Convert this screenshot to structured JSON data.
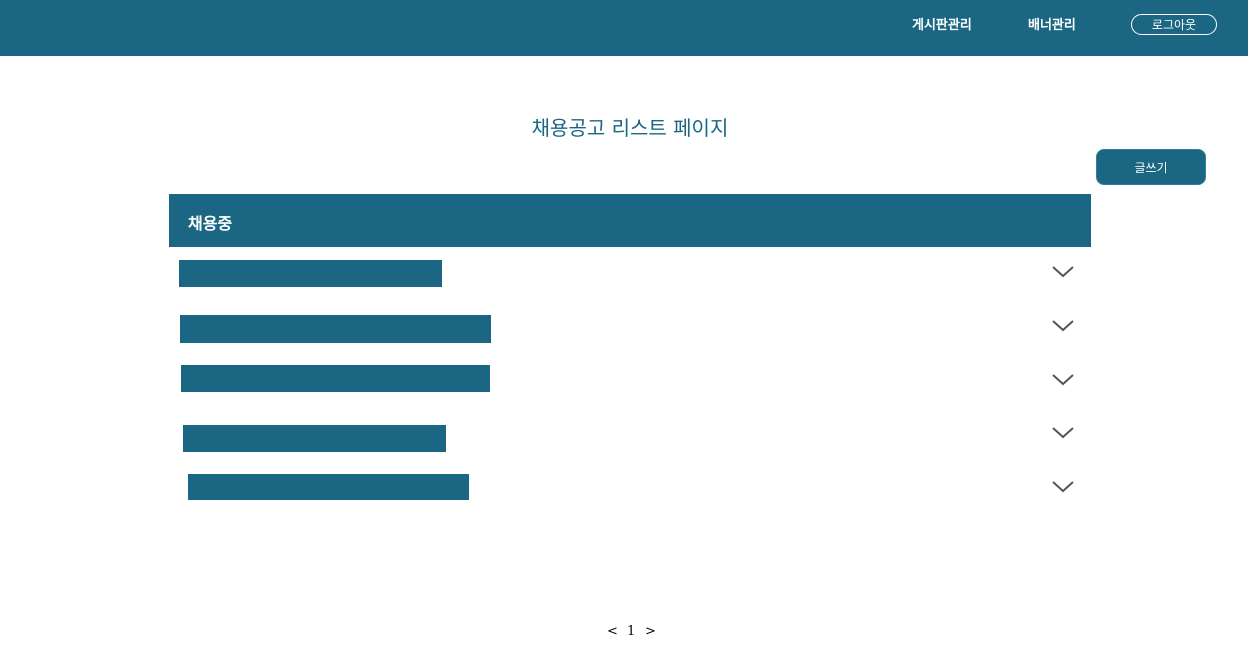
{
  "header": {
    "nav": [
      {
        "label": "게시판관리"
      },
      {
        "label": "배너관리"
      }
    ],
    "logout_label": "로그아웃"
  },
  "page": {
    "title": "채용공고 리스트 페이지",
    "write_label": "글쓰기"
  },
  "section": {
    "title": "채용중",
    "item_count": 5
  },
  "pagination": {
    "prev": "<",
    "current": "1",
    "next": ">"
  },
  "icons": {
    "expand": "chevron-down-icon"
  },
  "colors": {
    "primary": "#1b6683",
    "background": "#ffffff",
    "chevron": "#555555"
  }
}
